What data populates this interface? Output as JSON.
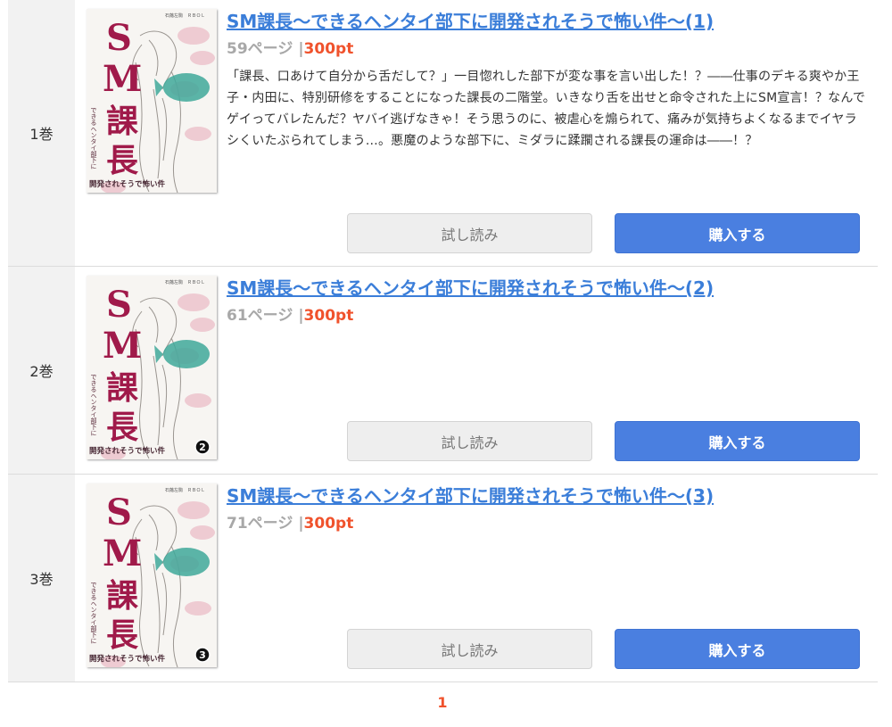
{
  "volumes": [
    {
      "vol_label": "1巻",
      "title": "SM課長～できるヘンタイ部下に開発されそうで怖い件～(1)",
      "pages": "59ページ",
      "separator": "|",
      "price": "300pt",
      "cover_badge": "",
      "description": "「課長、口あけて自分から舌だして？」一目惚れした部下が変な事を言い出した！？――仕事のデキる爽やか王子・内田に、特別研修をすることになった課長の二階堂。いきなり舌を出せと命令された上にSM宣言！？なんでゲイってバレたんだ？ヤバイ逃げなきゃ！そう思うのに、被虐心を煽られて、痛みが気持ちよくなるまでイヤラシくいたぶられてしまう…。悪魔のような部下に、ミダラに蹂躙される課長の運命は――！？",
      "trial_label": "試し読み",
      "buy_label": "購入する"
    },
    {
      "vol_label": "2巻",
      "title": "SM課長～できるヘンタイ部下に開発されそうで怖い件～(2)",
      "pages": "61ページ",
      "separator": "|",
      "price": "300pt",
      "cover_badge": "2",
      "description": "",
      "trial_label": "試し読み",
      "buy_label": "購入する"
    },
    {
      "vol_label": "3巻",
      "title": "SM課長～できるヘンタイ部下に開発されそうで怖い件～(3)",
      "pages": "71ページ",
      "separator": "|",
      "price": "300pt",
      "cover_badge": "3",
      "description": "",
      "trial_label": "試し読み",
      "buy_label": "購入する"
    }
  ],
  "cover_art": {
    "title_s": "S",
    "title_m": "M",
    "title_ka": "課",
    "title_cho": "長",
    "top_credit": "石蕗左駒　ＲＢＯＬ",
    "side_text": "できるヘンタイ部下に",
    "bottom_text": "開発されそうで怖い件",
    "title_color": "#a01a4a",
    "accent_color": "#3fa89a"
  },
  "pagination": {
    "current_page": "1"
  },
  "colors": {
    "link": "#3b7ed9",
    "price": "#f0522c",
    "buy_button": "#4a7fe0",
    "trial_button": "#eeeeee",
    "volume_cell": "#f2f2f2"
  }
}
